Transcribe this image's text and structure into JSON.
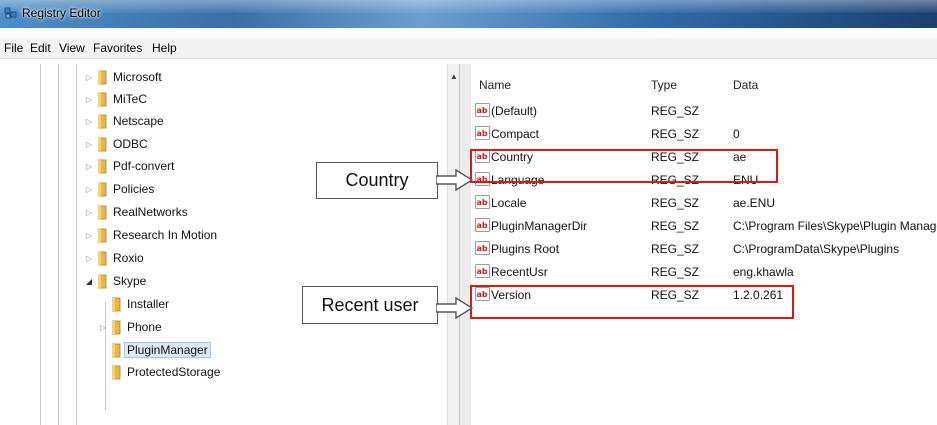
{
  "window": {
    "title": "Registry Editor"
  },
  "menu": [
    "File",
    "Edit",
    "View",
    "Favorites",
    "Help"
  ],
  "tree": {
    "items": [
      {
        "label": "Microsoft",
        "expander": "▷"
      },
      {
        "label": "MiTeC",
        "expander": "▷"
      },
      {
        "label": "Netscape",
        "expander": "▷"
      },
      {
        "label": "ODBC",
        "expander": "▷"
      },
      {
        "label": "Pdf-convert",
        "expander": "▷"
      },
      {
        "label": "Policies",
        "expander": "▷"
      },
      {
        "label": "RealNetworks",
        "expander": "▷"
      },
      {
        "label": "Research In Motion",
        "expander": "▷"
      },
      {
        "label": "Roxio",
        "expander": "▷"
      },
      {
        "label": "Skype",
        "expander": "◢"
      },
      {
        "label": "Installer",
        "expander": ""
      },
      {
        "label": "Phone",
        "expander": "▷"
      },
      {
        "label": "PluginManager",
        "expander": ""
      },
      {
        "label": "ProtectedStorage",
        "expander": ""
      }
    ],
    "selected": "PluginManager"
  },
  "list": {
    "columns": {
      "name": "Name",
      "type": "Type",
      "data": "Data"
    },
    "rows": [
      {
        "name": "(Default)",
        "type": "REG_SZ",
        "data": ""
      },
      {
        "name": "Compact",
        "type": "REG_SZ",
        "data": "0"
      },
      {
        "name": "Country",
        "type": "REG_SZ",
        "data": "ae"
      },
      {
        "name": "Language",
        "type": "REG_SZ",
        "data": "ENU"
      },
      {
        "name": "Locale",
        "type": "REG_SZ",
        "data": "ae.ENU"
      },
      {
        "name": "PluginManagerDir",
        "type": "REG_SZ",
        "data": "C:\\Program Files\\Skype\\Plugin Manager\\"
      },
      {
        "name": "Plugins Root",
        "type": "REG_SZ",
        "data": "C:\\ProgramData\\Skype\\Plugins"
      },
      {
        "name": "RecentUsr",
        "type": "REG_SZ",
        "data": "eng.khawla"
      },
      {
        "name": "Version",
        "type": "REG_SZ",
        "data": "1.2.0.261"
      }
    ]
  },
  "annotations": {
    "country": "Country",
    "recent_user": "Recent user",
    "color": "#d11d1d"
  }
}
